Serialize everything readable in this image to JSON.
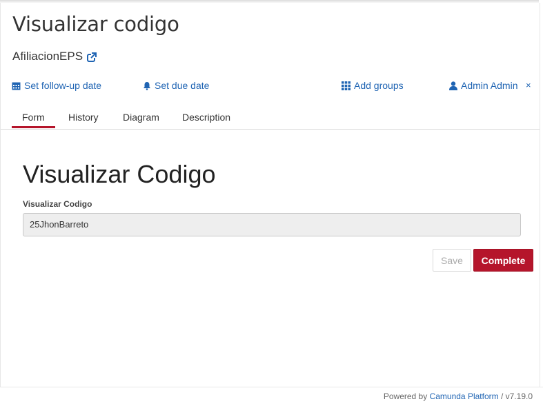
{
  "task": {
    "title": "Visualizar codigo",
    "process_name": "AfiliacionEPS"
  },
  "actions": {
    "follow_up": "Set follow-up date",
    "due_date": "Set due date",
    "add_groups": "Add groups",
    "assignee": "Admin Admin",
    "remove_assignee": "×"
  },
  "tabs": [
    "Form",
    "History",
    "Diagram",
    "Description"
  ],
  "form": {
    "heading": "Visualizar Codigo",
    "field_label": "Visualizar Codigo",
    "field_value": "25JhonBarreto",
    "save_label": "Save",
    "complete_label": "Complete"
  },
  "footer": {
    "prefix": "Powered by",
    "brand": "Camunda Platform",
    "version": "/ v7.19.0"
  },
  "colors": {
    "accent": "#b5152b",
    "link": "#1f64b3"
  }
}
